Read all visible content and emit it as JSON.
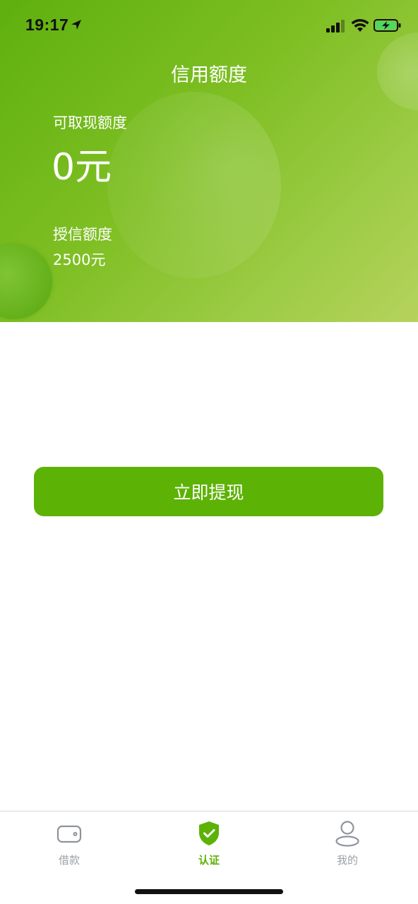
{
  "status_bar": {
    "time": "19:17"
  },
  "header": {
    "title": "信用额度",
    "available_label": "可取现额度",
    "available_value": "0元",
    "credit_label": "授信额度",
    "credit_value": "2500元"
  },
  "main": {
    "withdraw_label": "立即提现"
  },
  "tab_bar": {
    "tabs": [
      {
        "label": "借款",
        "icon": "wallet-icon",
        "active": false
      },
      {
        "label": "认证",
        "icon": "shield-check-icon",
        "active": true
      },
      {
        "label": "我的",
        "icon": "person-icon",
        "active": false
      }
    ]
  },
  "colors": {
    "accent": "#5db206",
    "tab_inactive": "#9a9fa6"
  }
}
